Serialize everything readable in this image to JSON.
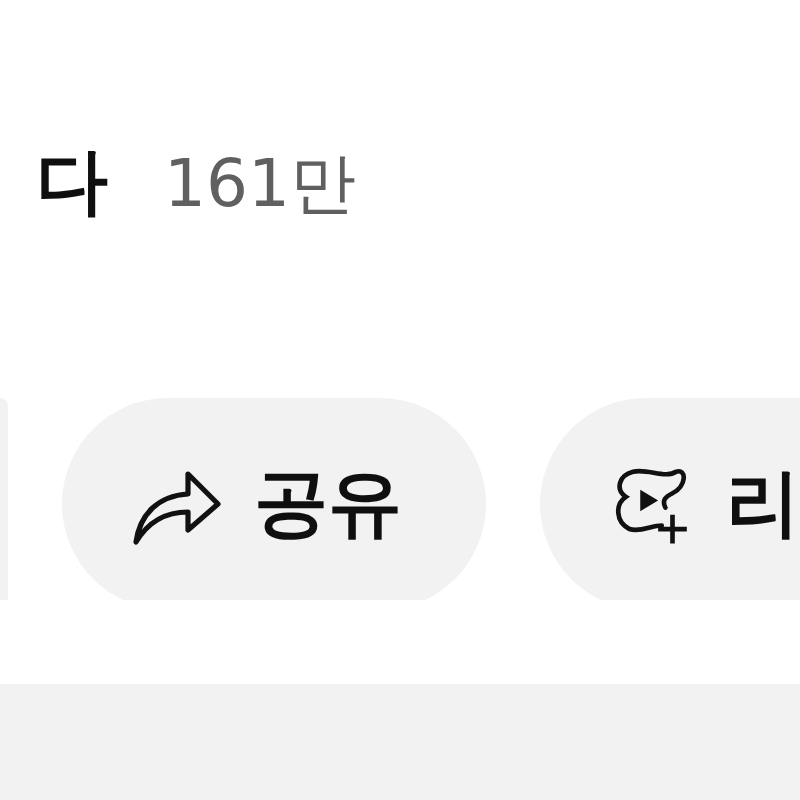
{
  "title": "다",
  "view_count": "161만",
  "actions": [
    {
      "kind": "blank"
    },
    {
      "kind": "share",
      "label": "공유"
    },
    {
      "kind": "remix",
      "label": "리"
    }
  ]
}
